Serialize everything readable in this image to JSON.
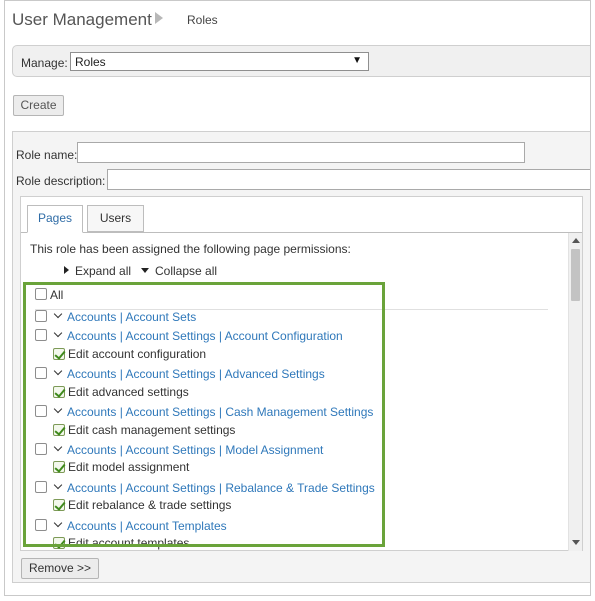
{
  "header": {
    "title": "User Management",
    "breadcrumb": "Roles"
  },
  "manage": {
    "label": "Manage:",
    "selected": "Roles"
  },
  "actions": {
    "create_label": "Create",
    "remove_label": "Remove >>"
  },
  "form": {
    "role_name_label": "Role name:",
    "role_name_value": "",
    "role_description_label": "Role description:",
    "role_description_value": ""
  },
  "tabs": [
    {
      "label": "Pages",
      "active": true
    },
    {
      "label": "Users",
      "active": false
    }
  ],
  "permissions": {
    "note": "This role has been assigned the following page permissions:",
    "expand_all": "Expand all",
    "collapse_all": "Collapse all",
    "all_label": "All",
    "items": [
      {
        "label": "Accounts | Account Sets",
        "checked": false,
        "children": []
      },
      {
        "label": "Accounts | Account Settings | Account Configuration",
        "checked": false,
        "children": [
          "Edit account configuration"
        ]
      },
      {
        "label": "Accounts | Account Settings | Advanced Settings",
        "checked": false,
        "children": [
          "Edit advanced settings"
        ]
      },
      {
        "label": "Accounts | Account Settings | Cash Management Settings",
        "checked": false,
        "children": [
          "Edit cash management settings"
        ]
      },
      {
        "label": "Accounts | Account Settings | Model Assignment",
        "checked": false,
        "children": [
          "Edit model assignment"
        ]
      },
      {
        "label": "Accounts | Account Settings | Rebalance & Trade Settings",
        "checked": false,
        "children": [
          "Edit rebalance & trade settings"
        ]
      },
      {
        "label": "Accounts | Account Templates",
        "checked": false,
        "children": [
          "Edit account templates"
        ]
      }
    ]
  },
  "colors": {
    "link": "#2f78ba",
    "highlight": "#6aa33a",
    "checkmark": "#3f8a1c"
  }
}
